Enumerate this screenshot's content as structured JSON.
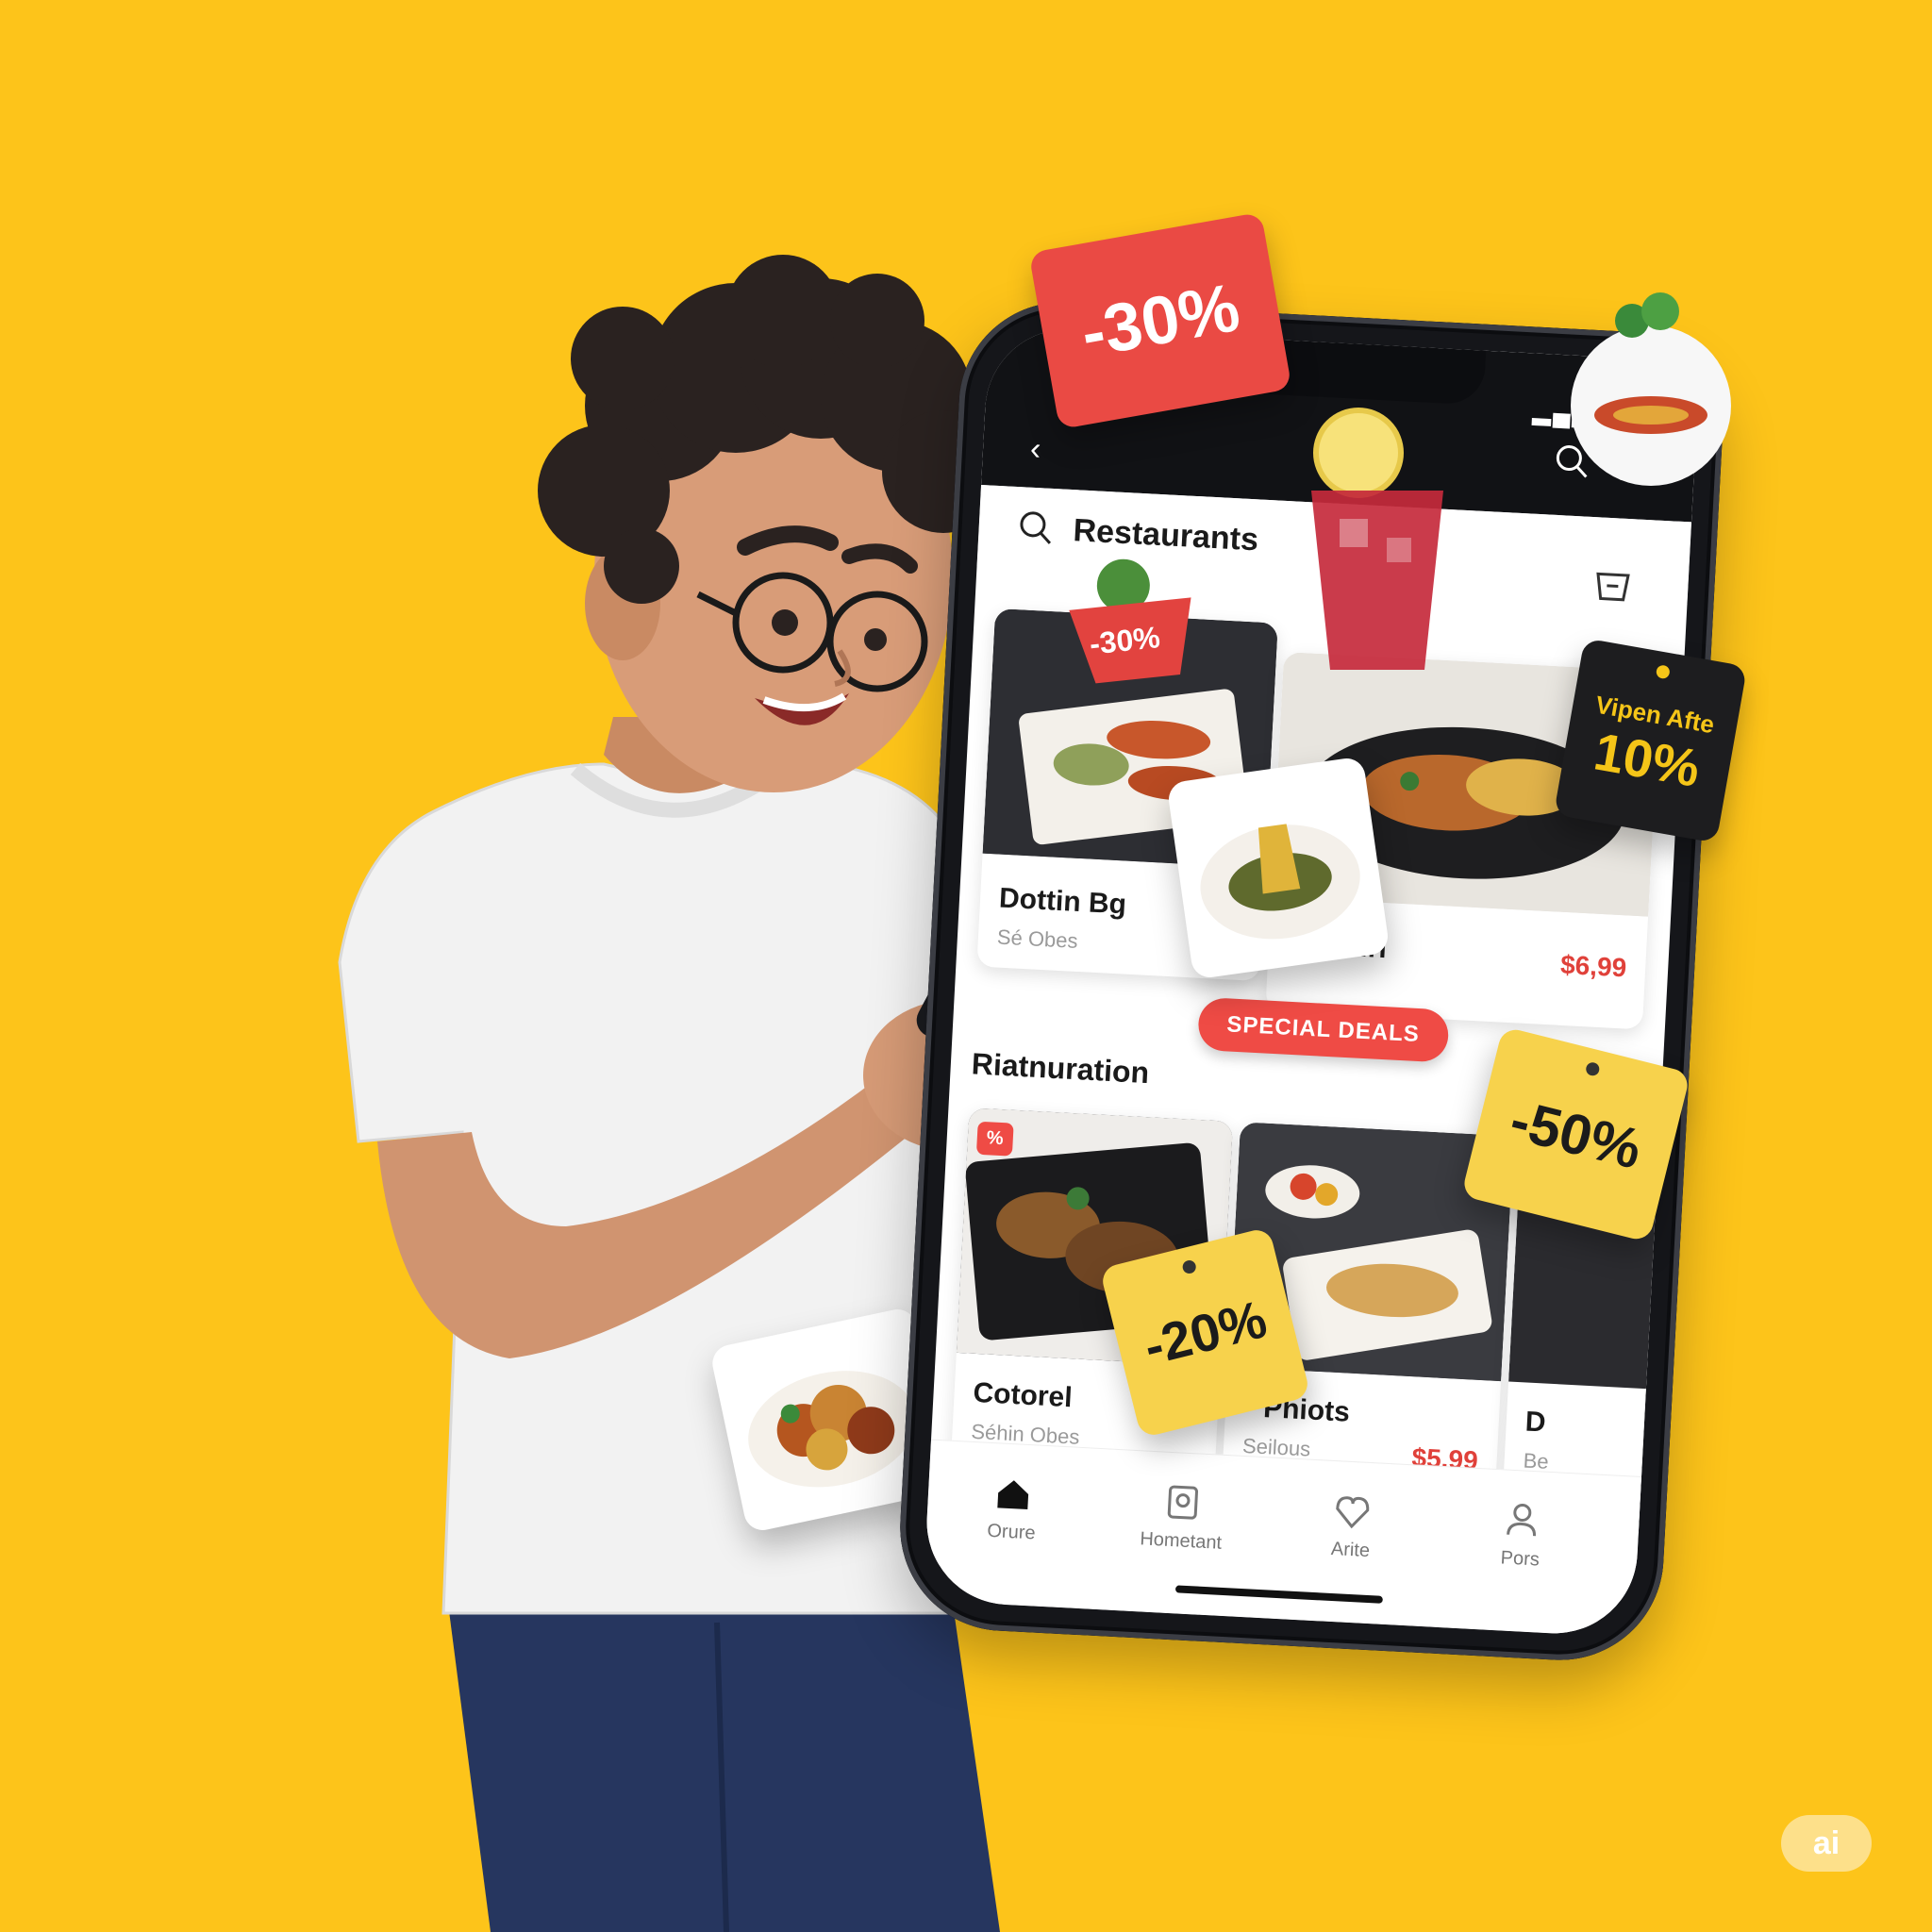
{
  "app": {
    "search_label": "Restaurants",
    "section_title": "Riatnuration",
    "deals_label": "SPECIAL DEALS"
  },
  "cards": {
    "top_left": {
      "name": "Dottin Bg",
      "sub": "Sé Obes"
    },
    "top_right": {
      "name": "Pairi",
      "price": "$6,99"
    },
    "bottom_left": {
      "name": "Cotorel",
      "sub": "Séhin Obes"
    },
    "bottom_right": {
      "name": "Phiots",
      "sub": "Seilous",
      "price": "$5,99"
    },
    "edge": {
      "name": "D",
      "sub": "Be"
    }
  },
  "tabs": [
    {
      "label": "Orure",
      "icon": "home-icon"
    },
    {
      "label": "Hometant",
      "icon": "receipt-icon"
    },
    {
      "label": "Arite",
      "icon": "heart-icon"
    },
    {
      "label": "Pors",
      "icon": "profile-icon"
    }
  ],
  "badges": {
    "top_red": "-30%",
    "bowl": "-30%",
    "dark_line1": "Vipen Afte",
    "dark_line2": "10%",
    "yellow_right": "-50%",
    "yellow_left": "-20%"
  },
  "watermark": "ai",
  "colors": {
    "background": "#FDC41A",
    "accent_red": "#ea4a44",
    "tag_yellow": "#f7d24c",
    "tag_dark": "#1d1d1f"
  }
}
